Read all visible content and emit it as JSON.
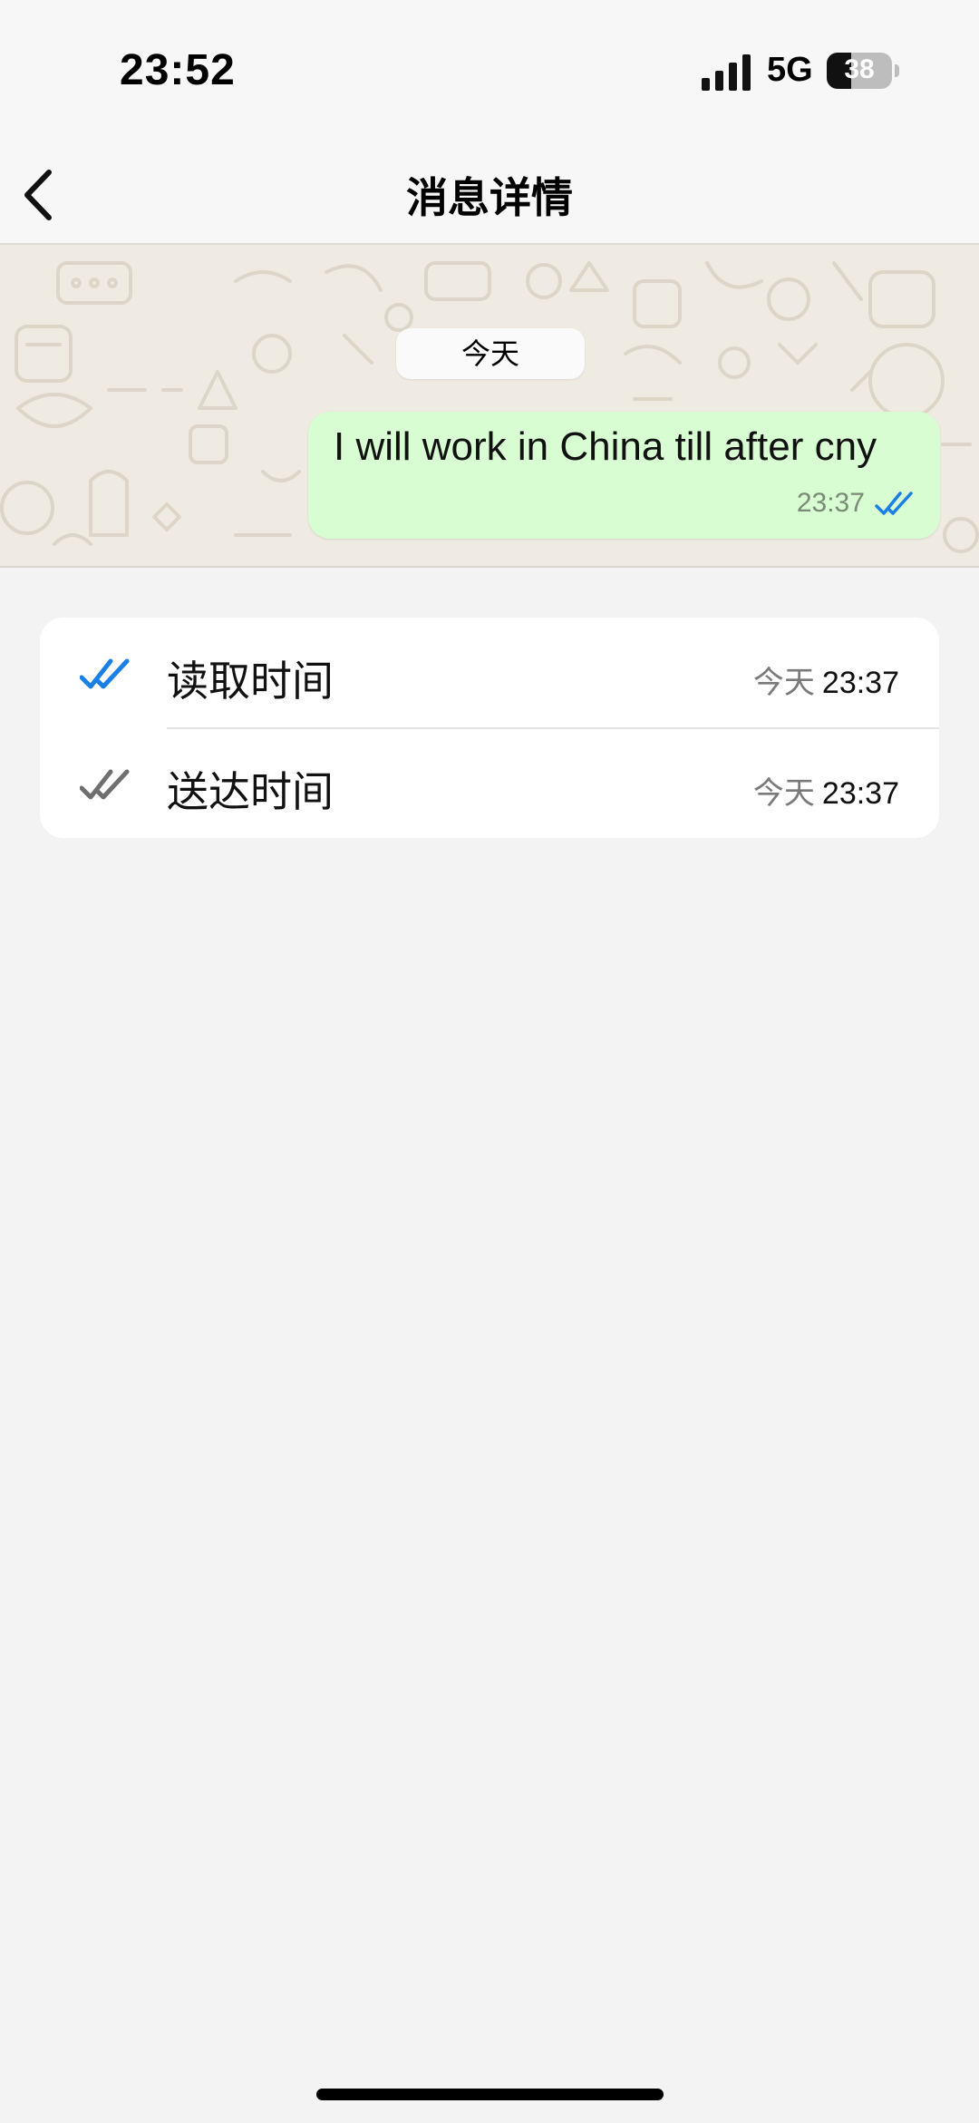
{
  "status_bar": {
    "time": "23:52",
    "network": "5G",
    "battery_percent": "38",
    "battery_level": 0.38,
    "signal_icon": "cellular-signal-icon",
    "battery_icon": "battery-icon"
  },
  "nav": {
    "title": "消息详情",
    "back_icon": "chevron-left-icon"
  },
  "chat": {
    "date_chip": "今天",
    "message": {
      "text": "I will work in China till after cny",
      "time": "23:37",
      "status_icon": "double-check-read-icon"
    }
  },
  "receipts": [
    {
      "label": "读取时间",
      "day": "今天",
      "time": "23:37",
      "icon": "double-check-blue-icon"
    },
    {
      "label": "送达时间",
      "day": "今天",
      "time": "23:37",
      "icon": "double-check-gray-icon"
    }
  ],
  "colors": {
    "read_tick": "#1a7fe6",
    "delivered_tick": "#6e6e6e",
    "bubble": "#d8fdd2",
    "chat_background": "#efeae2",
    "page_background": "#f3f3f3"
  }
}
